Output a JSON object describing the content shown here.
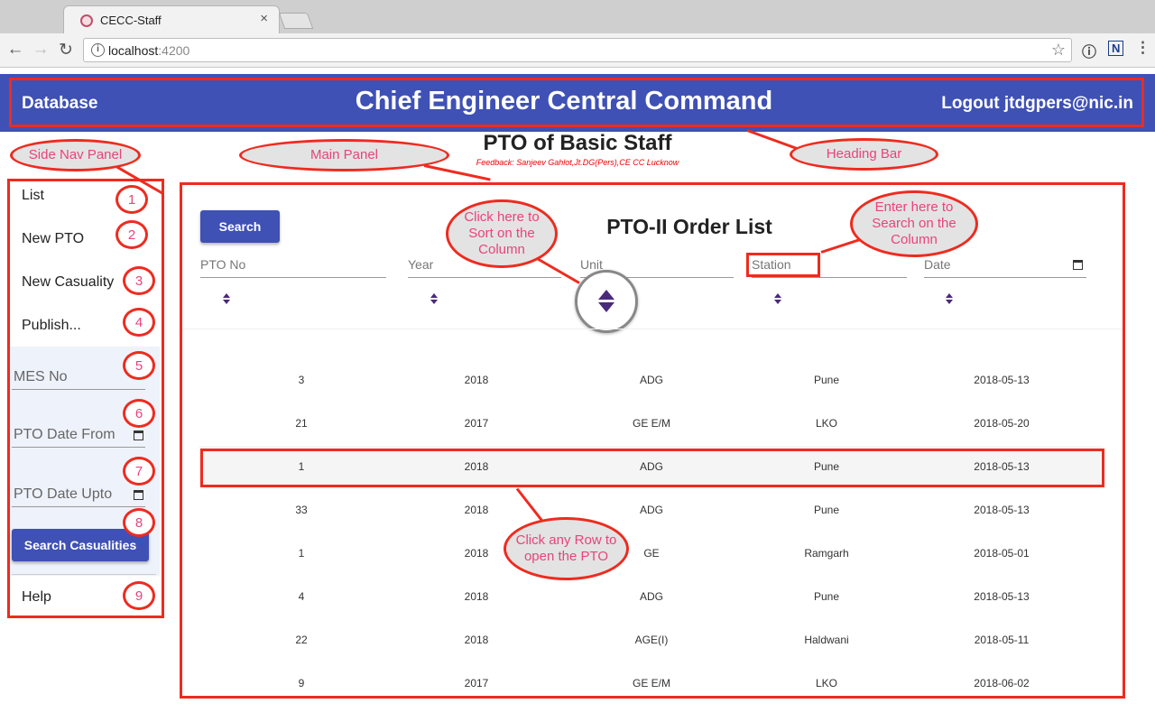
{
  "browser": {
    "tab_title": "CECC-Staff",
    "tab_close": "×",
    "url_host": "localhost",
    "url_port": ":4200",
    "back_glyph": "←",
    "forward_glyph": "→",
    "reload_glyph": "↻",
    "info_glyph": "i",
    "star_glyph": "☆",
    "ext1_glyph": "ⓘ",
    "ext2_glyph": "N",
    "menu_glyph": "⋮"
  },
  "header": {
    "left": "Database",
    "title": "Chief Engineer Central Command",
    "right": "Logout jtdgpers@nic.in",
    "color": "#3f51b5"
  },
  "page": {
    "title": "PTO of Basic Staff",
    "feedback": "Feedback: Sanjeev Gahlot,Jt.DG(Pers),CE CC Lucknow"
  },
  "sidenav": {
    "items": [
      {
        "label": "List"
      },
      {
        "label": "New PTO"
      },
      {
        "label": "New Casuality"
      },
      {
        "label": "Publish..."
      }
    ],
    "fields": [
      {
        "placeholder": "MES No"
      },
      {
        "placeholder": "PTO Date From"
      },
      {
        "placeholder": "PTO Date Upto"
      }
    ],
    "search_button": "Search Casualities",
    "help": "Help"
  },
  "main": {
    "search_button": "Search",
    "title": "PTO-II Order List",
    "columns": [
      "PTO No",
      "Year",
      "Unit",
      "Station",
      "Date"
    ],
    "rows": [
      [
        "3",
        "2018",
        "ADG",
        "Pune",
        "2018-05-13"
      ],
      [
        "21",
        "2017",
        "GE E/M",
        "LKO",
        "2018-05-20"
      ],
      [
        "1",
        "2018",
        "ADG",
        "Pune",
        "2018-05-13"
      ],
      [
        "33",
        "2018",
        "ADG",
        "Pune",
        "2018-05-13"
      ],
      [
        "1",
        "2018",
        "GE",
        "Ramgarh",
        "2018-05-01"
      ],
      [
        "4",
        "2018",
        "ADG",
        "Pune",
        "2018-05-13"
      ],
      [
        "22",
        "2018",
        "AGE(I)",
        "Haldwani",
        "2018-05-11"
      ],
      [
        "9",
        "2017",
        "GE E/M",
        "LKO",
        "2018-06-02"
      ]
    ]
  },
  "annotations": {
    "side_nav_panel": "Side Nav Panel",
    "main_panel": "Main Panel",
    "heading_bar": "Heading Bar",
    "sort_hint": "Click here to Sort on the Column",
    "search_hint": "Enter here to Search on the Column",
    "row_hint": "Click any Row to open the PTO",
    "numbers": [
      "1",
      "2",
      "3",
      "4",
      "5",
      "6",
      "7",
      "8",
      "9"
    ],
    "color": "#ee2b1f"
  }
}
